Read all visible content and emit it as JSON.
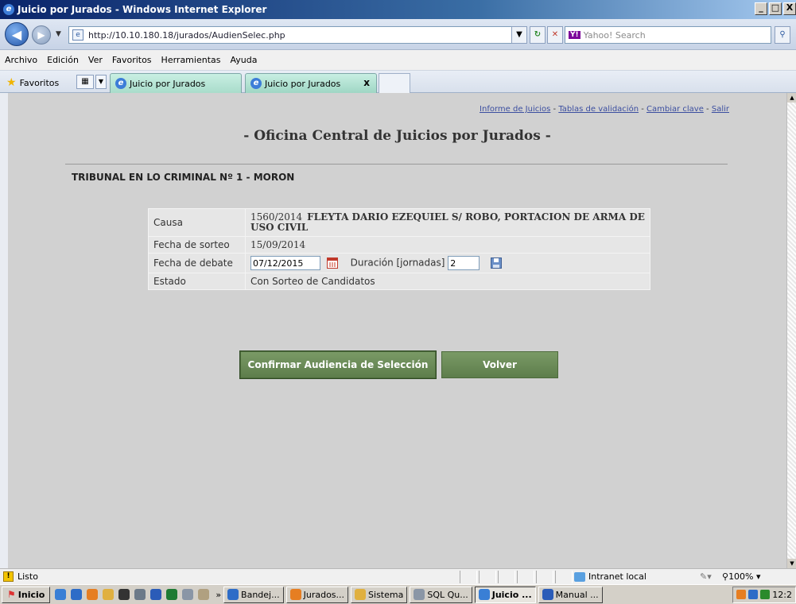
{
  "window": {
    "title": "Juicio por Jurados - Windows Internet Explorer",
    "controls": [
      "_",
      "□",
      "X"
    ]
  },
  "address_bar": {
    "url_host": "http://10.10.180.18",
    "url_path": "/jurados/AudienSelec.php",
    "search_placeholder": "Yahoo! Search",
    "search_brand": "Y!"
  },
  "menu": [
    "Archivo",
    "Edición",
    "Ver",
    "Favoritos",
    "Herramientas",
    "Ayuda"
  ],
  "favorites_bar": {
    "label": "Favoritos",
    "tabs": [
      {
        "label": "Juicio por Jurados"
      },
      {
        "label": "Juicio por Jurados",
        "close": "x"
      }
    ]
  },
  "page": {
    "top_links": {
      "informe": "Informe de Juicios",
      "tablas": "Tablas de validación",
      "clave": "Cambiar clave",
      "salir": "Salir",
      "separator": " - "
    },
    "title": "- Oficina Central de Juicios por Jurados -",
    "tribunal": "TRIBUNAL EN LO CRIMINAL Nº 1 - MORON",
    "info": {
      "causa_label": "Causa",
      "causa_number": "1560/2014",
      "causa_text": "FLEYTA DARIO EZEQUIEL S/ ROBO, PORTACION DE ARMA DE USO CIVIL",
      "sorteo_label": "Fecha de sorteo",
      "sorteo_value": "15/09/2014",
      "debate_label": "Fecha de debate",
      "debate_value": "07/12/2015",
      "duracion_label": "Duración [jornadas]",
      "duracion_value": "2",
      "estado_label": "Estado",
      "estado_value": "Con Sorteo de Candidatos"
    },
    "buttons": {
      "confirm": "Confirmar Audiencia de Selección",
      "back": "Volver"
    }
  },
  "status_bar": {
    "text": "Listo",
    "zone": "Intranet local",
    "zoom": "100%"
  },
  "taskbar": {
    "start": "Inicio",
    "items": [
      "Bandej...",
      "Jurados...",
      "Sistema",
      "SQL Qu...",
      "Juicio ...",
      "Manual ..."
    ],
    "clock": "12:2"
  }
}
